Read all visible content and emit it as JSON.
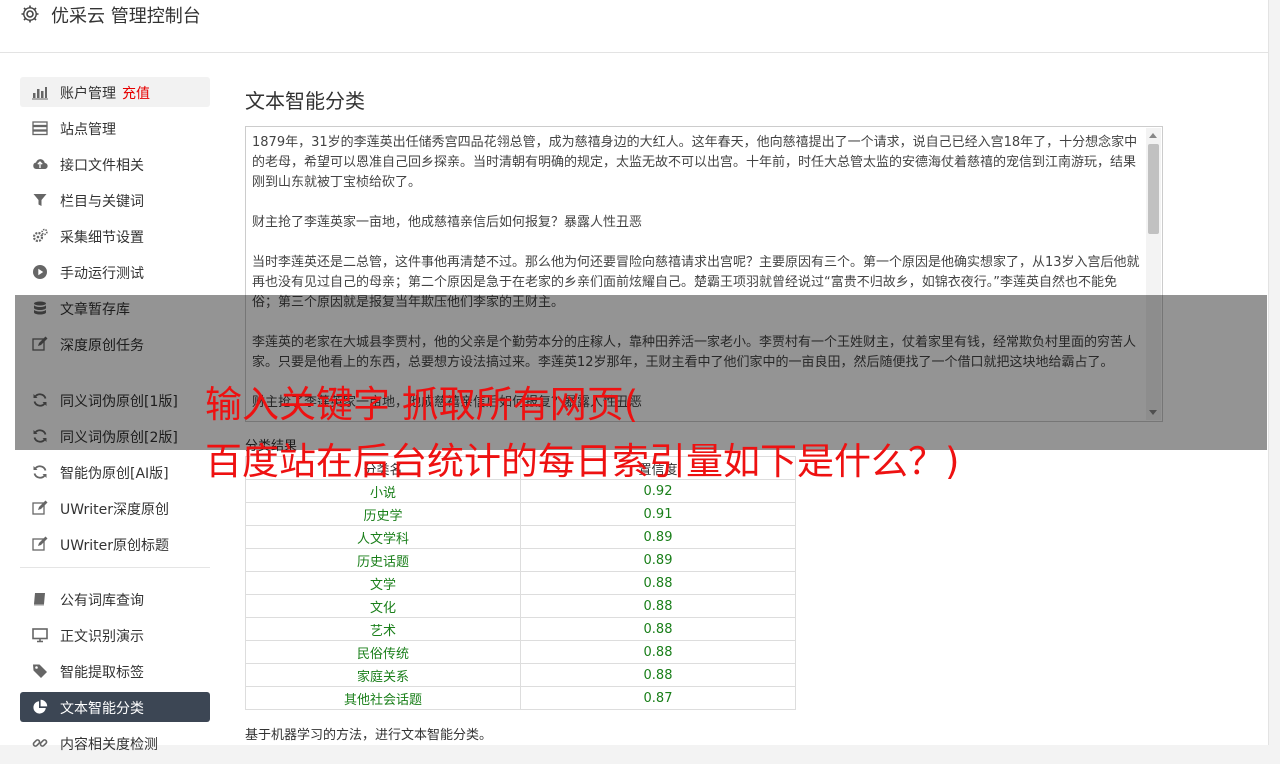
{
  "header": {
    "title": "优采云 管理控制台",
    "icon": "gear-icon"
  },
  "sidebar": {
    "items": [
      {
        "label": "账户管理",
        "extra": "充值",
        "icon": "bar-chart-icon",
        "state": "hover"
      },
      {
        "label": "站点管理",
        "icon": "server-icon"
      },
      {
        "label": "接口文件相关",
        "icon": "cloud-upload-icon"
      },
      {
        "label": "栏目与关键词",
        "icon": "filter-icon"
      },
      {
        "label": "采集细节设置",
        "icon": "gears-icon"
      },
      {
        "label": "手动运行测试",
        "icon": "play-circle-icon"
      },
      {
        "label": "文章暂存库",
        "icon": "database-icon"
      },
      {
        "label": "深度原创任务",
        "icon": "edit-icon"
      },
      {
        "label": "同义词伪原创[1版]",
        "icon": "refresh-icon"
      },
      {
        "label": "同义词伪原创[2版]",
        "icon": "refresh-icon"
      },
      {
        "label": "智能伪原创[AI版]",
        "icon": "refresh-icon"
      },
      {
        "label": "UWriter深度原创",
        "icon": "edit-icon"
      },
      {
        "label": "UWriter原创标题",
        "icon": "edit-icon"
      },
      {
        "label": "公有词库查询",
        "icon": "book-icon"
      },
      {
        "label": "正文识别演示",
        "icon": "monitor-icon"
      },
      {
        "label": "智能提取标签",
        "icon": "tag-icon"
      },
      {
        "label": "文本智能分类",
        "icon": "pie-chart-icon",
        "state": "active"
      },
      {
        "label": "内容相关度检测",
        "icon": "link-icon"
      }
    ]
  },
  "main": {
    "title": "文本智能分类",
    "text_paragraphs": [
      "1879年，31岁的李莲英出任储秀宫四品花翎总管，成为慈禧身边的大红人。这年春天，他向慈禧提出了一个请求，说自己已经入宫18年了，十分想念家中的老母，希望可以恩准自己回乡探亲。当时清朝有明确的规定，太监无故不可以出宫。十年前，时任大总管太监的安德海仗着慈禧的宠信到江南游玩，结果刚到山东就被丁宝桢给砍了。",
      "财主抢了李莲英家一亩地，他成慈禧亲信后如何报复？暴露人性丑恶",
      "当时李莲英还是二总管，这件事他再清楚不过。那么他为何还要冒险向慈禧请求出宫呢？主要原因有三个。第一个原因是他确实想家了，从13岁入宫后他就再也没有见过自己的母亲；第二个原因是急于在老家的乡亲们面前炫耀自己。楚霸王项羽就曾经说过“富贵不归故乡，如锦衣夜行。”李莲英自然也不能免俗；第三个原因就是报复当年欺压他们李家的王财主。",
      "李莲英的老家在大城县李贾村，他的父亲是个勤劳本分的庄稼人，靠种田养活一家老小。李贾村有一个王姓财主，仗着家里有钱，经常欺负村里面的穷苦人家。只要是他看上的东西，总要想方设法搞过来。李莲英12岁那年，王财主看中了他们家中的一亩良田，然后随便找了一个借口就把这块地给霸占了。",
      "财主抢了李莲英家一亩地，他成慈禧亲信后如何报复？暴露人性丑恶"
    ],
    "result_label": "分类结果",
    "table": {
      "headers": [
        "分类名",
        "置信度"
      ],
      "rows": [
        [
          "小说",
          "0.92"
        ],
        [
          "历史学",
          "0.91"
        ],
        [
          "人文学科",
          "0.89"
        ],
        [
          "历史话题",
          "0.89"
        ],
        [
          "文学",
          "0.88"
        ],
        [
          "文化",
          "0.88"
        ],
        [
          "艺术",
          "0.88"
        ],
        [
          "民俗传统",
          "0.88"
        ],
        [
          "家庭关系",
          "0.88"
        ],
        [
          "其他社会话题",
          "0.87"
        ]
      ]
    },
    "description": "基于机器学习的方法，进行文本智能分类。"
  },
  "overlay": {
    "line1": "输入关键字 抓取所有网页(",
    "line2": "百度站在后台统计的每日索引量如下是什么？)"
  },
  "colors": {
    "accent_red": "#e60000",
    "active_bg": "#3c4654",
    "value_green": "#1a7f1a",
    "overlay_text": "#ee1111"
  }
}
